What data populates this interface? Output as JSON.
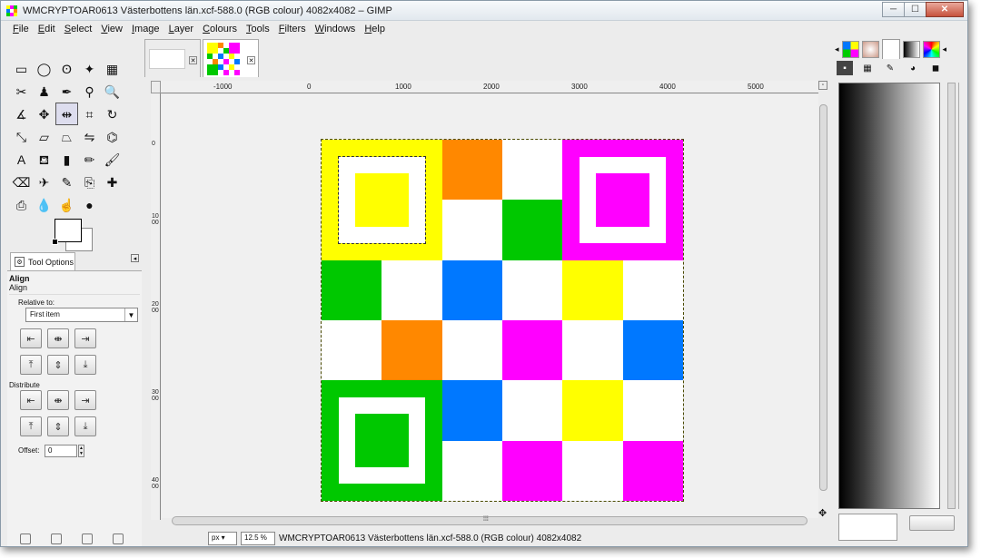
{
  "window": {
    "title": "WMCRYPTOAR0613 Västerbottens län.xcf-588.0 (RGB colour) 4082x4082 – GIMP",
    "minimize_label": "─",
    "maximize_label": "☐",
    "close_label": "✕"
  },
  "menubar": {
    "items": [
      "File",
      "Edit",
      "Select",
      "View",
      "Image",
      "Layer",
      "Colours",
      "Tools",
      "Filters",
      "Windows",
      "Help"
    ]
  },
  "toolbox": {
    "tools": [
      {
        "icon": "rect-select-icon",
        "glyph": "▭"
      },
      {
        "icon": "ellipse-select-icon",
        "glyph": "◯"
      },
      {
        "icon": "free-select-icon",
        "glyph": "ʘ"
      },
      {
        "icon": "fuzzy-select-icon",
        "glyph": "✦"
      },
      {
        "icon": "color-select-icon",
        "glyph": "▦"
      },
      {
        "icon": "scissors-select-icon",
        "glyph": "✂"
      },
      {
        "icon": "foreground-select-icon",
        "glyph": "♟"
      },
      {
        "icon": "paths-icon",
        "glyph": "✒"
      },
      {
        "icon": "color-picker-icon",
        "glyph": "⚲"
      },
      {
        "icon": "zoom-icon",
        "glyph": "🔍"
      },
      {
        "icon": "measure-icon",
        "glyph": "∡"
      },
      {
        "icon": "move-icon",
        "glyph": "✥"
      },
      {
        "icon": "align-icon",
        "glyph": "⇹"
      },
      {
        "icon": "crop-icon",
        "glyph": "⌗"
      },
      {
        "icon": "rotate-icon",
        "glyph": "↻"
      },
      {
        "icon": "scale-icon",
        "glyph": "⤡"
      },
      {
        "icon": "shear-icon",
        "glyph": "▱"
      },
      {
        "icon": "perspective-icon",
        "glyph": "⏢"
      },
      {
        "icon": "flip-icon",
        "glyph": "⇋"
      },
      {
        "icon": "cage-transform-icon",
        "glyph": "⌬"
      },
      {
        "icon": "text-icon",
        "glyph": "A"
      },
      {
        "icon": "bucket-fill-icon",
        "glyph": "⛾"
      },
      {
        "icon": "blend-icon",
        "glyph": "▮"
      },
      {
        "icon": "pencil-icon",
        "glyph": "✏"
      },
      {
        "icon": "paintbrush-icon",
        "glyph": "🖌"
      },
      {
        "icon": "eraser-icon",
        "glyph": "⌫"
      },
      {
        "icon": "airbrush-icon",
        "glyph": "✈"
      },
      {
        "icon": "ink-icon",
        "glyph": "✎"
      },
      {
        "icon": "clone-icon",
        "glyph": "⎘"
      },
      {
        "icon": "heal-icon",
        "glyph": "✚"
      },
      {
        "icon": "perspective-clone-icon",
        "glyph": "⎙"
      },
      {
        "icon": "blur-icon",
        "glyph": "💧"
      },
      {
        "icon": "smudge-icon",
        "glyph": "☝"
      },
      {
        "icon": "dodge-burn-icon",
        "glyph": "●"
      }
    ],
    "tool_options_tab": "Tool Options",
    "tool_options_title": "Align",
    "tool_options_subtitle": "Align",
    "relative_to_label": "Relative to:",
    "relative_to_value": "First item",
    "distribute_label": "Distribute",
    "offset_label": "Offset:",
    "offset_value": "0"
  },
  "image_tabs": [
    "untitled-blank",
    "WMCRYPTOAR0613 Västerbottens län"
  ],
  "rulers": {
    "horizontal": [
      "-1000",
      "0",
      "1000",
      "2000",
      "3000",
      "4000",
      "5000"
    ],
    "vertical": [
      "0",
      "1000",
      "2000",
      "3000",
      "4000"
    ]
  },
  "artwork": {
    "colors": {
      "yellow": "#ffff00",
      "orange": "#ff8800",
      "green": "#00c800",
      "blue": "#0078ff",
      "magenta": "#ff00ff",
      "white": "#ffffff"
    }
  },
  "statusbar": {
    "unit": "px",
    "zoom": "12.5 %",
    "text": "WMCRYPTOAR0613 Västerbottens län.xcf-588.0 (RGB colour) 4082x4082"
  },
  "dock": {
    "tabs": [
      "brushes-icon",
      "patterns-icon",
      "gradients-icon",
      "palettes-icon",
      "fonts-icon"
    ]
  }
}
